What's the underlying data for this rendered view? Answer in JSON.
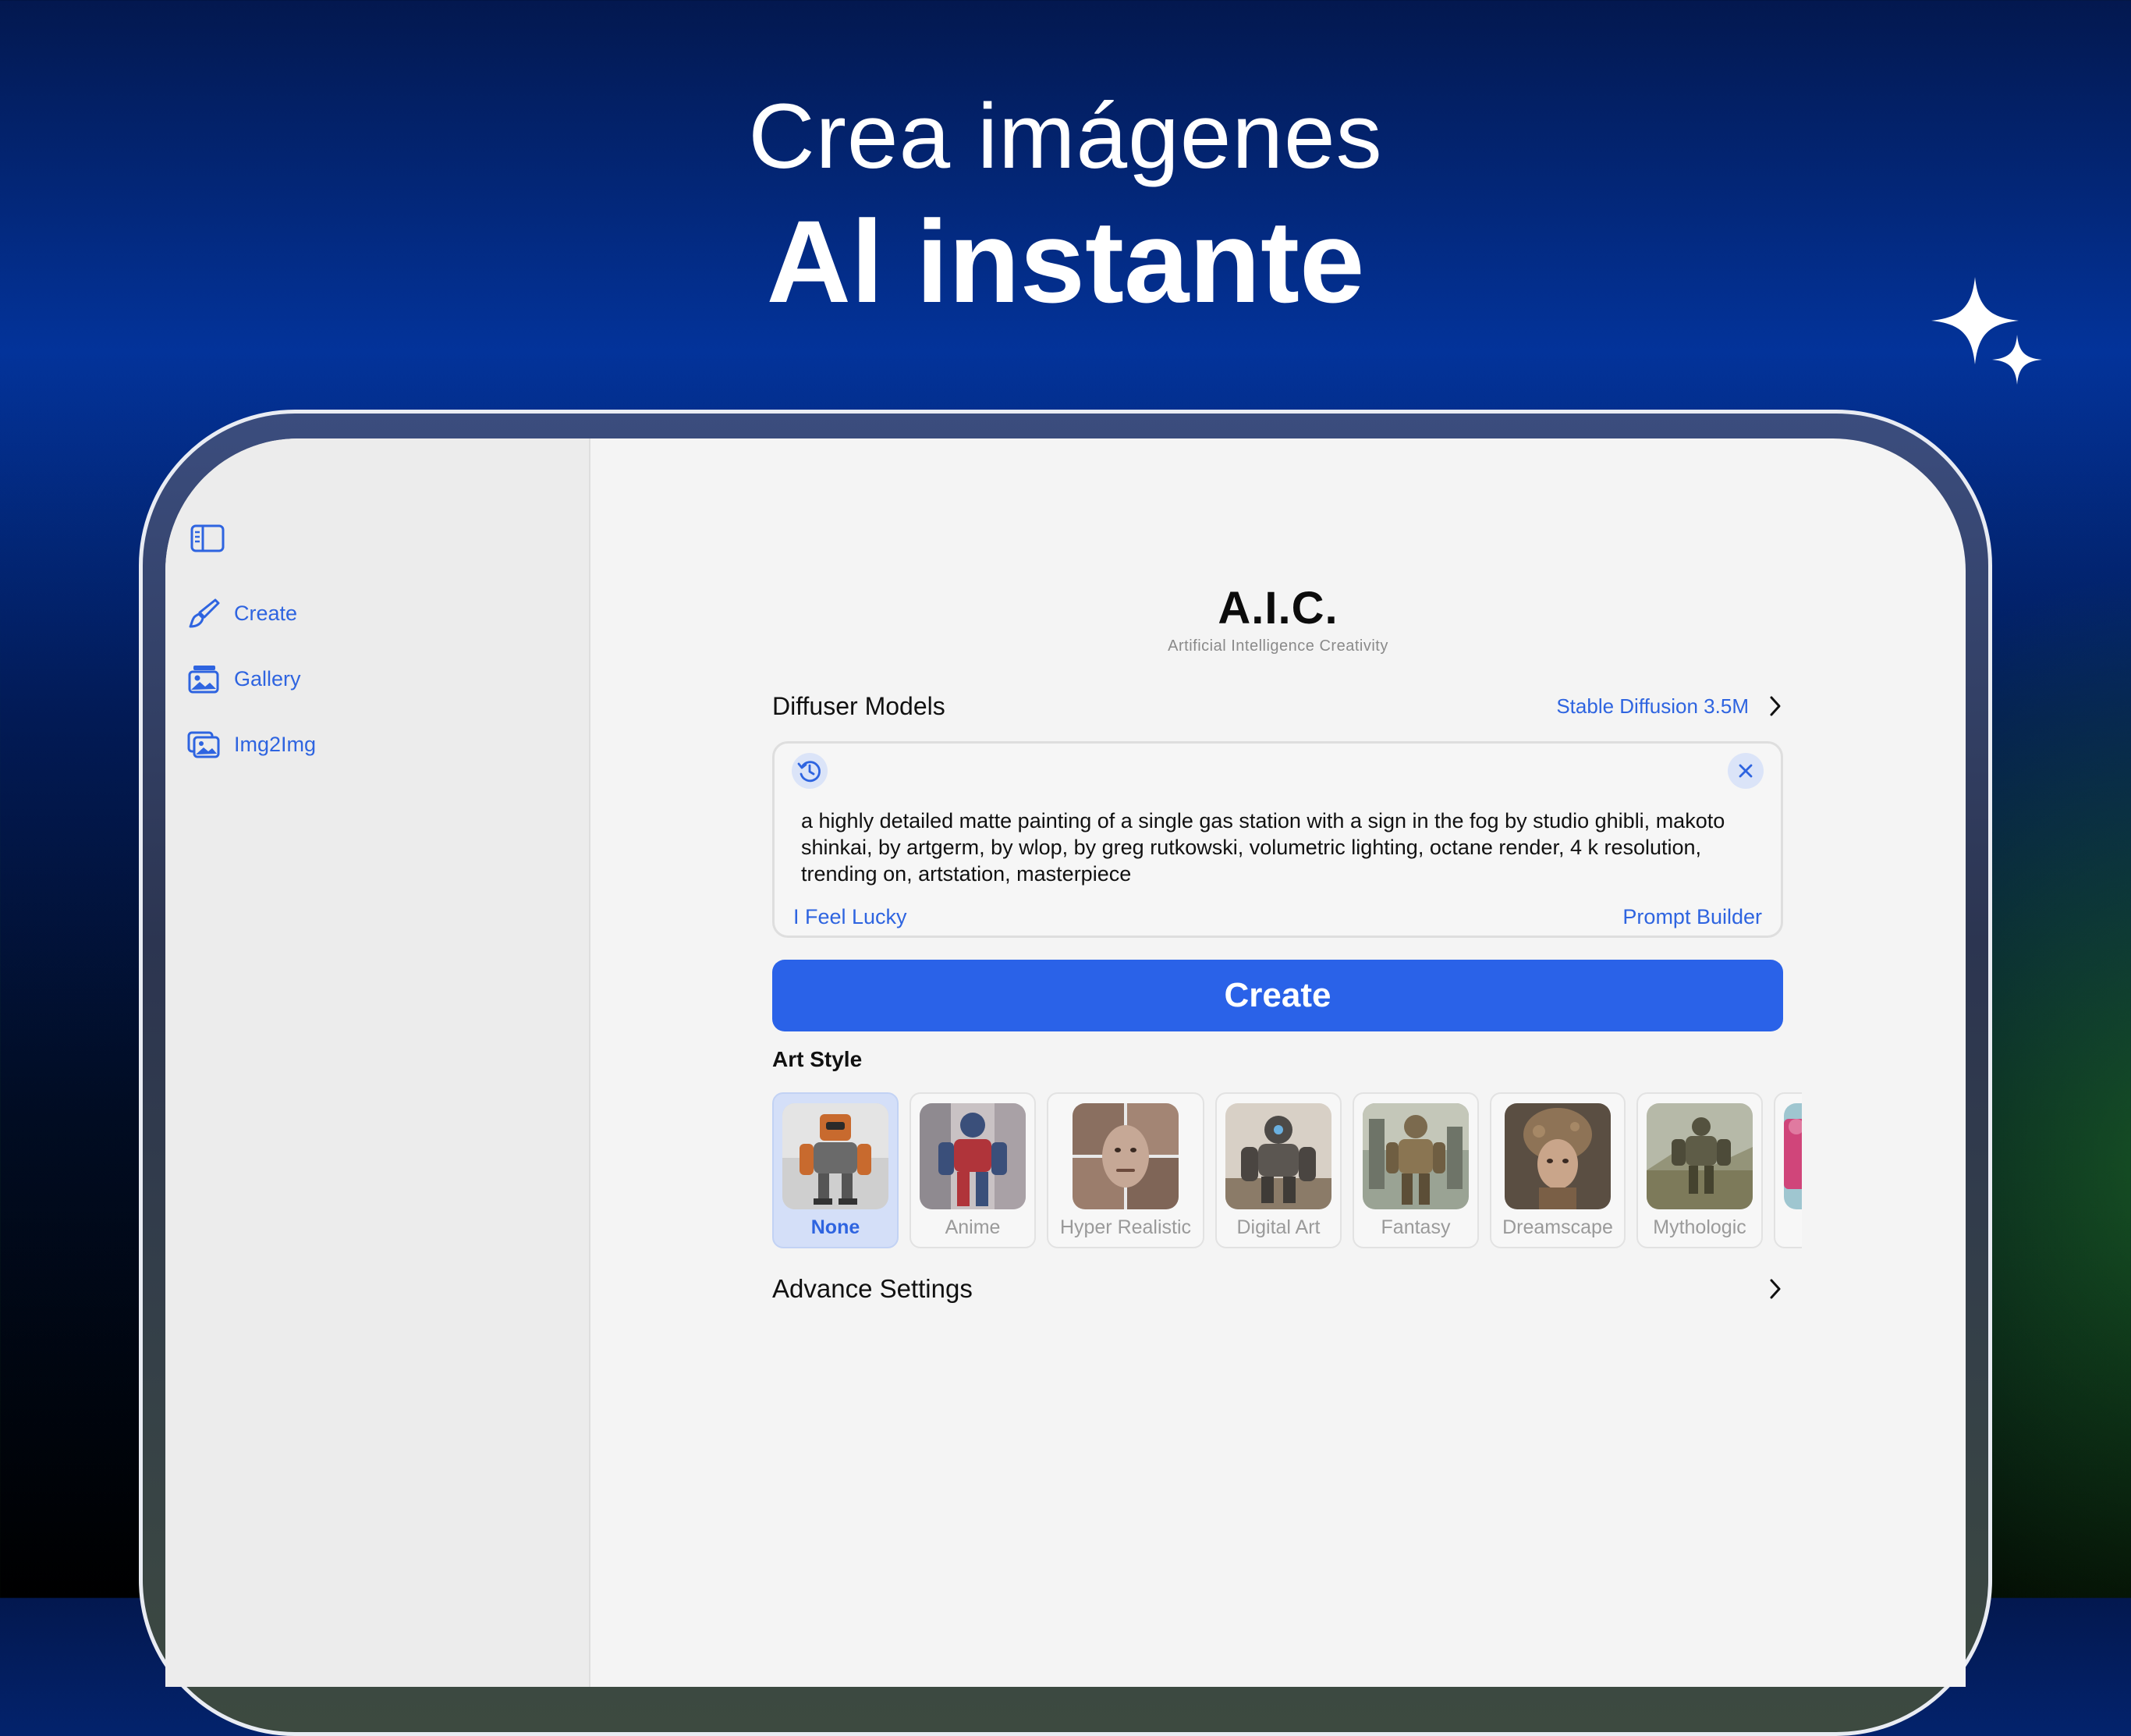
{
  "hero": {
    "line1": "Crea imágenes",
    "line2": "Al instante"
  },
  "sidebar": {
    "items": [
      {
        "label": "Create",
        "icon": "paintbrush-icon"
      },
      {
        "label": "Gallery",
        "icon": "photo-icon"
      },
      {
        "label": "Img2Img",
        "icon": "photo-stack-icon"
      }
    ]
  },
  "brand": {
    "title": "A.I.C.",
    "subtitle": "Artificial Intelligence Creativity"
  },
  "models": {
    "label": "Diffuser Models",
    "selected": "Stable Diffusion 3.5M"
  },
  "prompt": {
    "text": "a highly detailed matte painting of a single gas station with a sign in the fog by studio ghibli, makoto shinkai, by artgerm, by wlop, by greg rutkowski, volumetric lighting, octane render, 4 k resolution, trending on, artstation, masterpiece",
    "lucky_label": "I Feel Lucky",
    "builder_label": "Prompt Builder"
  },
  "create_label": "Create",
  "art_style": {
    "title": "Art Style",
    "selected": "None",
    "styles": [
      {
        "label": "None"
      },
      {
        "label": "Anime"
      },
      {
        "label": "Hyper Realistic"
      },
      {
        "label": "Digital Art"
      },
      {
        "label": "Fantasy"
      },
      {
        "label": "Dreamscape"
      },
      {
        "label": "Mythologic"
      }
    ]
  },
  "advanced": {
    "label": "Advance Settings"
  },
  "colors": {
    "accent": "#2a62e8",
    "link": "#2e64e0",
    "selected_bg": "#d4dff8"
  }
}
